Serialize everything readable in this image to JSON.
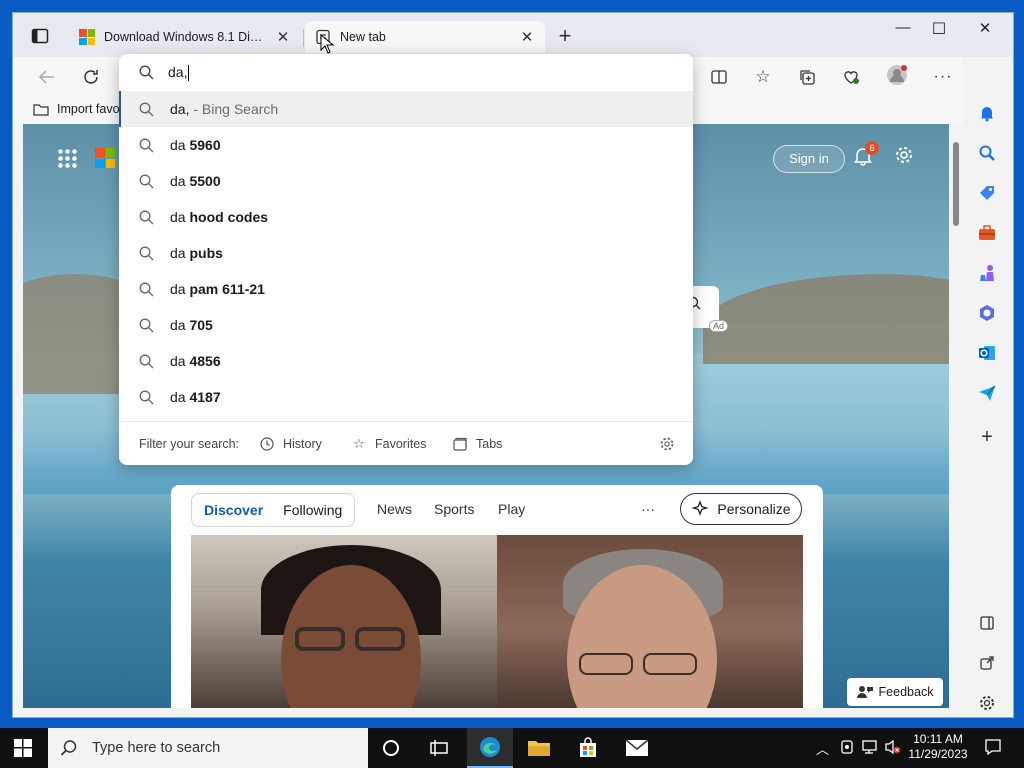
{
  "window": {
    "tabs": [
      {
        "title": "Download Windows 8.1 Disc Ima",
        "close": "✕"
      },
      {
        "title": "New tab",
        "close": "✕"
      }
    ],
    "new_tab": "+",
    "controls": {
      "minimize": "—",
      "maximize": "☐",
      "close": "✕"
    }
  },
  "favorites_bar": {
    "import_label": "Import favo"
  },
  "omnibox": {
    "query": "da,",
    "suggestions": [
      {
        "prefix": "da,",
        "rest": " - Bing Search",
        "bold": ""
      },
      {
        "prefix": "da ",
        "bold": "5960"
      },
      {
        "prefix": "da ",
        "bold": "5500"
      },
      {
        "prefix": "da ",
        "bold": "hood codes"
      },
      {
        "prefix": "da ",
        "bold": "pubs"
      },
      {
        "prefix": "da ",
        "bold": "pam 611-21"
      },
      {
        "prefix": "da ",
        "bold": "705"
      },
      {
        "prefix": "da ",
        "bold": "4856"
      },
      {
        "prefix": "da ",
        "bold": "4187"
      }
    ],
    "filter": {
      "label": "Filter your search:",
      "history": "History",
      "favorites": "Favorites",
      "tabs": "Tabs"
    }
  },
  "newtab_page": {
    "sign_in": "Sign in",
    "notifications_count": "6",
    "ad_label": "Ad",
    "feed": {
      "tabs": [
        "Discover",
        "Following"
      ],
      "nav": [
        "News",
        "Sports",
        "Play"
      ],
      "more": "···",
      "personalize": "Personalize"
    },
    "feedback": "Feedback"
  },
  "taskbar": {
    "search_placeholder": "Type here to search",
    "time": "10:11 AM",
    "date": "11/29/2023"
  },
  "colors": {
    "desktop": "#0a5bc4",
    "accent": "#115ea3",
    "taskbar": "#101010"
  }
}
